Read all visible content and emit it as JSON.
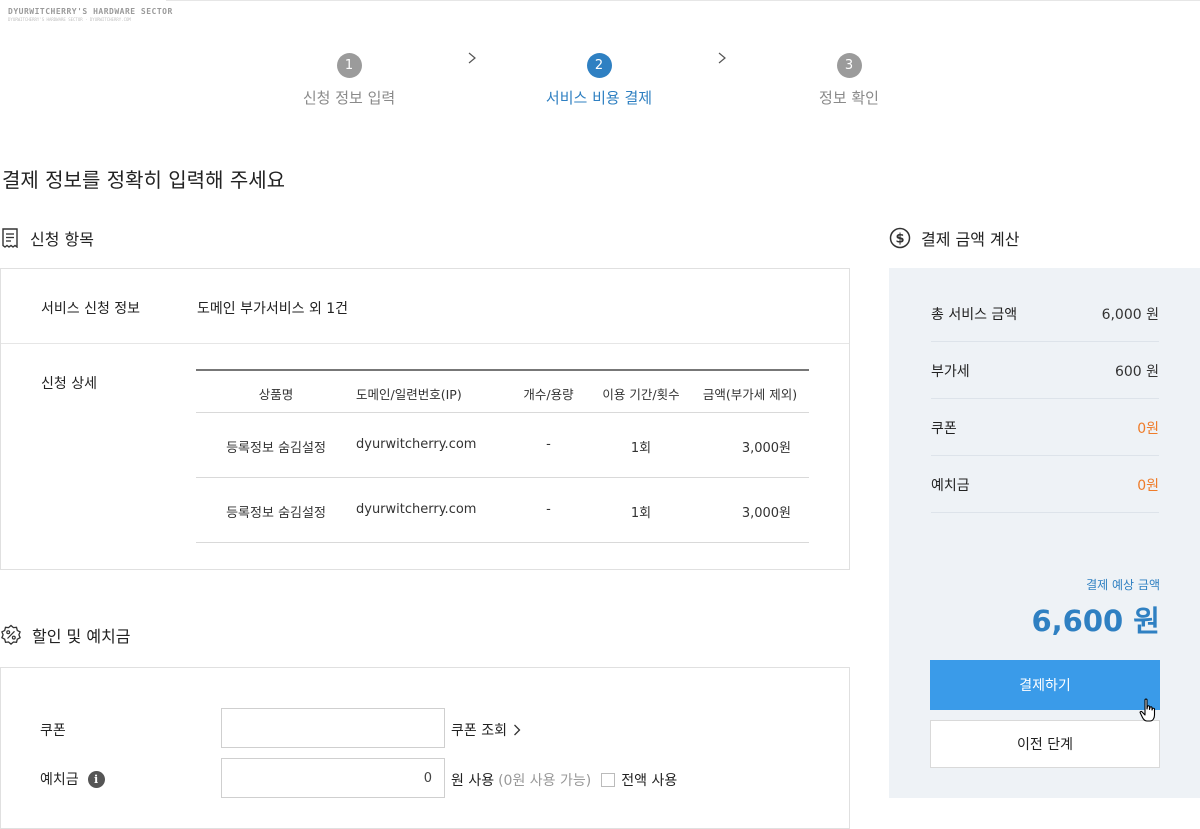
{
  "watermark": {
    "title": "DYURWITCHERRY'S HARDWARE SECTOR",
    "subtitle": "DYURWITCHERRY'S HARDWARE SECTOR · DYURWITCHERRY.COM"
  },
  "steps": [
    {
      "num": "1",
      "label": "신청 정보 입력",
      "active": false
    },
    {
      "num": "2",
      "label": "서비스 비용 결제",
      "active": true
    },
    {
      "num": "3",
      "label": "정보 확인",
      "active": false
    }
  ],
  "page_title": "결제 정보를 정확히 입력해 주세요",
  "application": {
    "title": "신청 항목",
    "service_info_label": "서비스 신청 정보",
    "service_info_value": "도메인 부가서비스 외 1건",
    "detail_label": "신청 상세",
    "table": {
      "headers": [
        "상품명",
        "도메인/일련번호(IP)",
        "개수/용량",
        "이용 기간/횟수",
        "금액(부가세 제외)"
      ],
      "rows": [
        [
          "등록정보 숨김설정",
          "dyurwitcherry.com",
          "-",
          "1회",
          "3,000원"
        ],
        [
          "등록정보 숨김설정",
          "dyurwitcherry.com",
          "-",
          "1회",
          "3,000원"
        ]
      ]
    }
  },
  "discount": {
    "title": "할인 및 예치금",
    "coupon_label": "쿠폰",
    "coupon_value": "",
    "coupon_link": "쿠폰 조회",
    "deposit_label": "예치금",
    "deposit_value": "0",
    "deposit_unit": "원 사용",
    "deposit_available": "(0원 사용 가능)",
    "use_all_label": "전액 사용"
  },
  "calc": {
    "title": "결제 금액 계산",
    "rows": [
      {
        "label": "총 서비스 금액",
        "value": "6,000 원",
        "highlight": false
      },
      {
        "label": "부가세",
        "value": "600 원",
        "highlight": false
      },
      {
        "label": "쿠폰",
        "value": "0원",
        "highlight": true
      },
      {
        "label": "예치금",
        "value": "0원",
        "highlight": true
      }
    ],
    "expected_label": "결제 예상 금액",
    "expected_value": "6,600 원",
    "pay_button": "결제하기",
    "prev_button": "이전 단계"
  },
  "colors": {
    "accent": "#2f80c2",
    "button": "#3a9be9",
    "highlight": "#ef7c2a",
    "panel": "#eef2f6"
  }
}
